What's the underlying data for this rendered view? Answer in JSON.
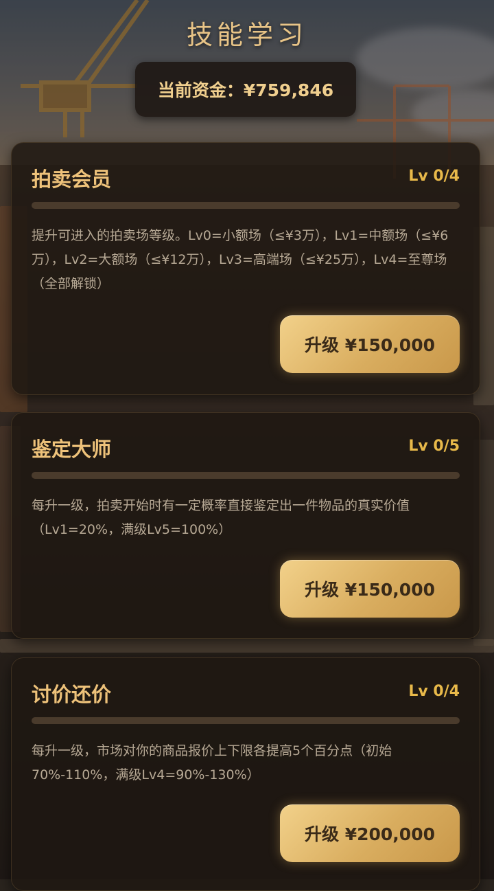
{
  "page": {
    "title": "技能学习"
  },
  "funds": {
    "label": "当前资金：¥759,846"
  },
  "colors": {
    "accent": "#e8b94a",
    "title": "#eec27a",
    "button": "#d9ad5f",
    "card_bg": "#1e1712"
  },
  "skills": [
    {
      "name": "拍卖会员",
      "level_text": "Lv 0/4",
      "progress": 0.0,
      "description": "提升可进入的拍卖场等级。Lv0=小额场（≤¥3万），Lv1=中额场（≤¥6万），Lv2=大额场（≤¥12万），Lv3=高端场（≤¥25万），Lv4=至尊场（全部解锁）",
      "button_label": "升级 ¥150,000"
    },
    {
      "name": "鉴定大师",
      "level_text": "Lv 0/5",
      "progress": 0.0,
      "description": "每升一级，拍卖开始时有一定概率直接鉴定出一件物品的真实价值（Lv1=20%，满级Lv5=100%）",
      "button_label": "升级 ¥150,000"
    },
    {
      "name": "讨价还价",
      "level_text": "Lv 0/4",
      "progress": 0.0,
      "description": "每升一级，市场对你的商品报价上下限各提高5个百分点（初始70%-110%，满级Lv4=90%-130%）",
      "button_label": "升级 ¥200,000"
    }
  ]
}
